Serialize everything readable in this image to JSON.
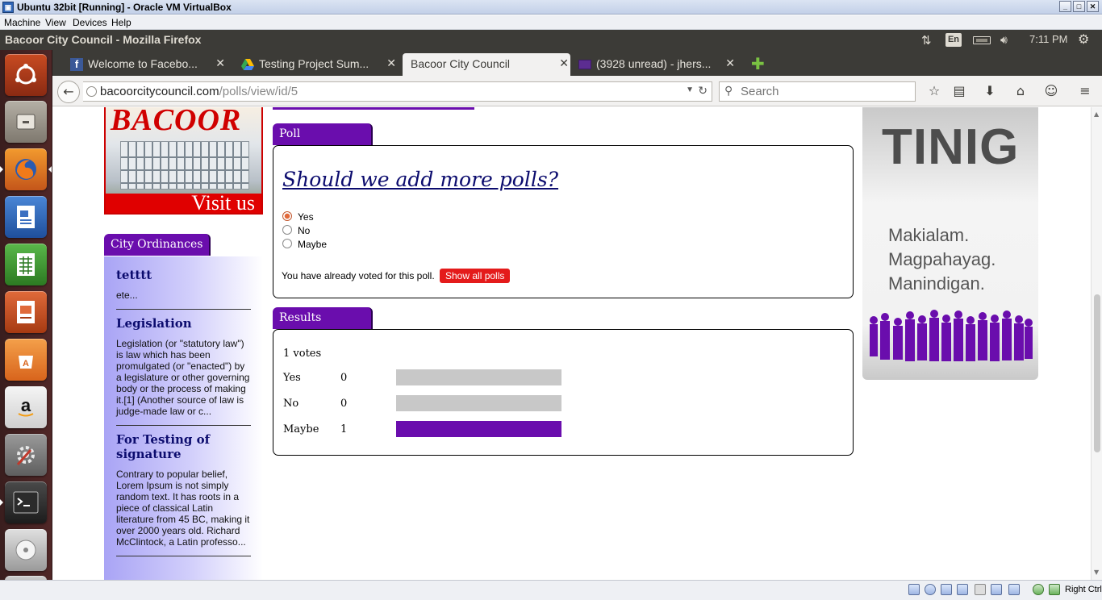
{
  "vbox": {
    "window_title": "Ubuntu 32bit [Running] - Oracle VM VirtualBox",
    "menu": [
      "Machine",
      "View",
      "Devices",
      "Help"
    ],
    "host_key": "Right Ctrl"
  },
  "ubuntu": {
    "window_title": "Bacoor City Council - Mozilla Firefox",
    "keyboard_layout": "En",
    "clock": "7:11 PM"
  },
  "launcher": {
    "items": [
      "ubuntu-logo-icon",
      "files-icon",
      "firefox-icon",
      "writer-icon",
      "calc-icon",
      "impress-icon",
      "software-center-icon",
      "amazon-icon",
      "system-settings-icon",
      "terminal-icon",
      "disc-icon",
      "drive-icon"
    ]
  },
  "tabs": [
    {
      "label": "Welcome to Facebo...",
      "icon": "facebook-icon",
      "active": false
    },
    {
      "label": "Testing Project Sum...",
      "icon": "google-drive-icon",
      "active": false
    },
    {
      "label": "Bacoor City Council",
      "icon": "",
      "active": true
    },
    {
      "label": "(3928 unread) - jhers...",
      "icon": "yahoo-mail-icon",
      "active": false
    }
  ],
  "tab_close_glyph": "✕",
  "navbar": {
    "url_host": "bacoorcitycouncil.com",
    "url_path": "/polls/view/id/5",
    "search_placeholder": "Search"
  },
  "sidebar": {
    "banner_brand": "BACOOR",
    "banner_cta": "Visit us",
    "ordinances_title": "City Ordinances",
    "ordinances": [
      {
        "title": "tetttt",
        "excerpt": "ete..."
      },
      {
        "title": "Legislation",
        "excerpt": "Legislation (or \"statutory law\") is law which has been promulgated (or \"enacted\") by a legislature or other governing body or the process of making it.[1] (Another source of law is judge-made law or c..."
      },
      {
        "title": "For Testing of signature",
        "excerpt": "Contrary to popular belief, Lorem Ipsum is not simply random text. It has roots in a piece of classical Latin literature from 45 BC, making it over 2000 years old. Richard McClintock, a Latin professo..."
      }
    ]
  },
  "poll": {
    "tab_label": "Poll",
    "question": "Should we add more polls?",
    "options": [
      {
        "label": "Yes",
        "selected": true
      },
      {
        "label": "No",
        "selected": false
      },
      {
        "label": "Maybe",
        "selected": false
      }
    ],
    "voted_message": "You have already voted for this poll.",
    "show_all_label": "Show all polls"
  },
  "results": {
    "tab_label": "Results",
    "total_votes": "1 votes",
    "rows": [
      {
        "label": "Yes",
        "count": "0",
        "fraction": 0
      },
      {
        "label": "No",
        "count": "0",
        "fraction": 0
      },
      {
        "label": "Maybe",
        "count": "1",
        "fraction": 1
      }
    ]
  },
  "ad": {
    "headline": "TINIG",
    "lines": [
      "Makialam.",
      "Magpahayag.",
      "Manindigan."
    ]
  },
  "colors": {
    "accent_purple": "#6a0dad",
    "button_red": "#e41b1b",
    "link_navy": "#0c0c6e",
    "ubuntu_dark": "#3c3b37"
  }
}
